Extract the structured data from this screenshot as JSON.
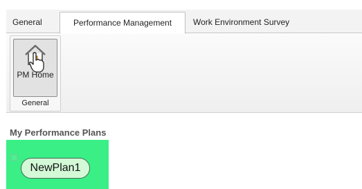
{
  "ribbon": {
    "tabs": [
      {
        "label": "General",
        "active": false
      },
      {
        "label": "Performance Management",
        "active": true
      },
      {
        "label": "Work Environment Survey",
        "active": false
      }
    ],
    "group": {
      "button_label": "PM Home",
      "button_icon": "home-icon",
      "group_label": "General"
    }
  },
  "main": {
    "section_title": "My Performance Plans",
    "plans": [
      {
        "label": "NewPlan1"
      }
    ]
  },
  "colors": {
    "highlight": "#39ef86",
    "plan_pill": "#d3f9d7"
  }
}
